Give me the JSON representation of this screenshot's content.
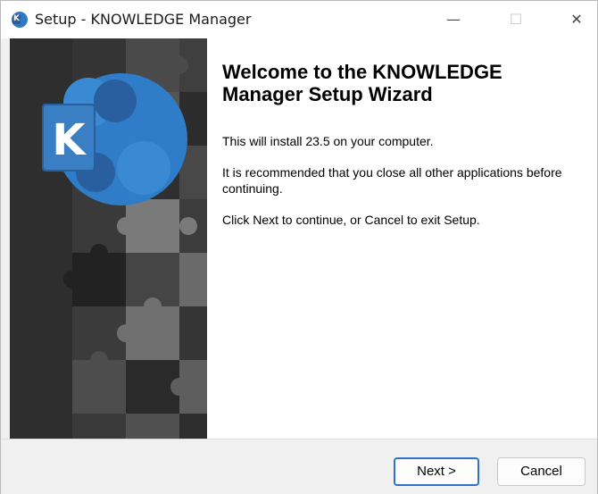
{
  "window": {
    "title": "Setup - KNOWLEDGE Manager",
    "icon": "knowledge-manager-app-icon",
    "controls": {
      "minimize_glyph": "—",
      "maximize_glyph": "☐",
      "close_glyph": "✕"
    }
  },
  "side_panel": {
    "logo_letter": "K",
    "logo_colors": {
      "blue": "#2f7dc8",
      "dark_blue": "#2a5f9f",
      "background": "#3a3a3a"
    }
  },
  "main": {
    "heading": "Welcome to the KNOWLEDGE Manager Setup Wizard",
    "paragraphs": [
      "This will install 23.5 on your computer.",
      "It is recommended that you close all other applications before continuing.",
      "Click Next to continue, or Cancel to exit Setup."
    ]
  },
  "footer": {
    "next_label": "Next >",
    "cancel_label": "Cancel"
  },
  "colors": {
    "accent": "#2f6fcf",
    "window_bg": "#f0f0f0"
  }
}
